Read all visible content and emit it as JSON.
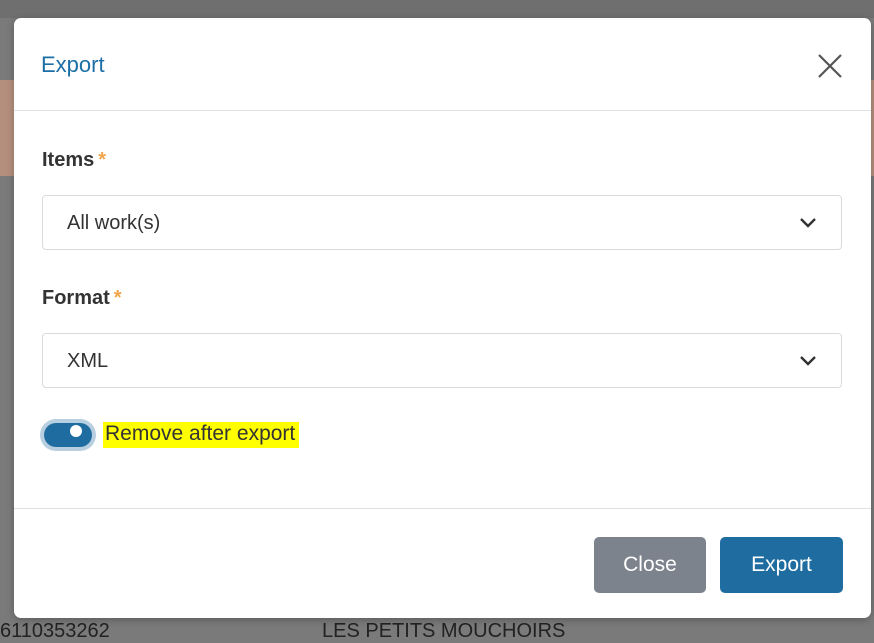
{
  "background": {
    "row_number": "6110353262",
    "row_title": "LES PETITS MOUCHOIRS"
  },
  "modal": {
    "title": "Export",
    "close_icon": "close-icon",
    "fields": {
      "items": {
        "label": "Items",
        "required_mark": "*",
        "value": "All work(s)"
      },
      "format": {
        "label": "Format",
        "required_mark": "*",
        "value": "XML"
      }
    },
    "toggle": {
      "label": "Remove after export",
      "checked": true
    },
    "buttons": {
      "close": "Close",
      "export": "Export"
    }
  },
  "colors": {
    "title": "#1c6fa6",
    "primary": "#1f6da0",
    "secondary": "#7d838c",
    "required": "#f0a54a",
    "highlight": "#ffff00"
  }
}
